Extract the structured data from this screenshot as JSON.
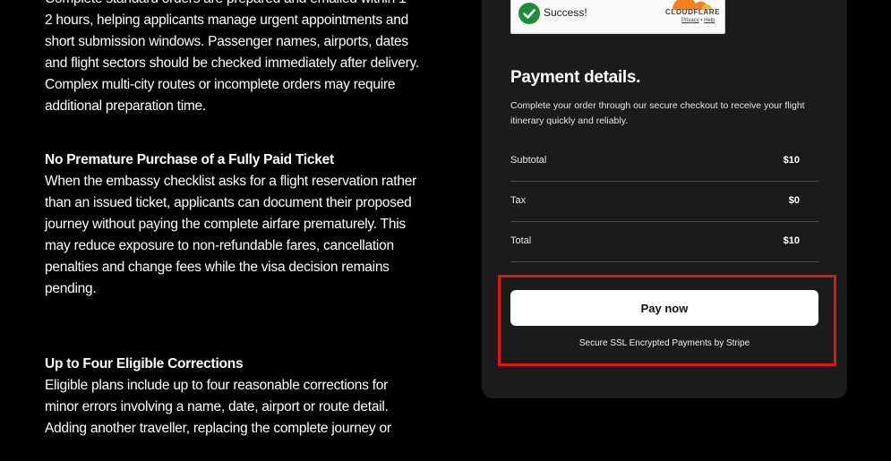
{
  "content": {
    "intro_paragraph": "Complete standard orders are prepared and emailed within 1–2 hours, helping applicants manage urgent appointments and short submission windows. Passenger names, airports, dates and flight sectors should be checked immediately after delivery. Complex multi-city routes or incomplete orders may require additional preparation time.",
    "sections": [
      {
        "title": "No Premature Purchase of a Fully Paid Ticket",
        "body": "When the embassy checklist asks for a flight reservation rather than an issued ticket, applicants can document their proposed journey without paying the complete airfare prematurely. This may reduce exposure to non-refundable fares, cancellation penalties and change fees while the visa decision remains pending."
      },
      {
        "title": "Up to Four Eligible Corrections",
        "body": "Eligible plans include up to four reasonable corrections for minor errors involving a name, date, airport or route detail. Adding another traveller, replacing the complete journey or"
      }
    ]
  },
  "captcha": {
    "status_text": "Success!",
    "provider": "CLOUDFLARE",
    "privacy_link": "Privacy",
    "separator": "•",
    "help_link": "Help"
  },
  "payment": {
    "title": "Payment details.",
    "description": "Complete your order through our secure checkout to receive your flight itinerary quickly and reliably.",
    "rows": [
      {
        "label": "Subtotal",
        "amount": "$10"
      },
      {
        "label": "Tax",
        "amount": "$0"
      },
      {
        "label": "Total",
        "amount": "$10"
      }
    ],
    "pay_button_label": "Pay now",
    "secure_note": "Secure SSL Encrypted Payments by Stripe"
  },
  "colors": {
    "page_background": "#000000",
    "panel_background": "#1b1b1b",
    "highlight_border": "#e0151b",
    "success_green": "#1d8c3b",
    "cloudflare_orange": "#f38020"
  }
}
